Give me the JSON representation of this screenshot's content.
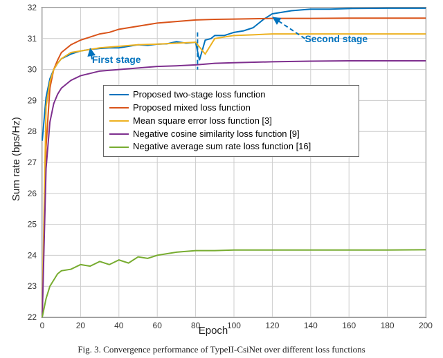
{
  "chart_data": {
    "type": "line",
    "title": "",
    "xlabel": "Epoch",
    "ylabel": "Sum rate (bps/Hz)",
    "xlim": [
      0,
      200
    ],
    "ylim": [
      22,
      32
    ],
    "xticks": [
      0,
      20,
      40,
      60,
      80,
      100,
      120,
      140,
      160,
      180,
      200
    ],
    "yticks": [
      22,
      23,
      24,
      25,
      26,
      27,
      28,
      29,
      30,
      31,
      32
    ],
    "grid": true,
    "legend_position": "inside-upper-left",
    "series": [
      {
        "name": "Proposed two-stage loss function",
        "color": "#0072bd",
        "x": [
          0,
          2,
          4,
          6,
          8,
          10,
          15,
          20,
          25,
          30,
          35,
          40,
          45,
          50,
          55,
          60,
          65,
          70,
          75,
          80,
          82,
          85,
          88,
          90,
          95,
          100,
          105,
          110,
          115,
          120,
          125,
          130,
          140,
          150,
          160,
          180,
          200
        ],
        "y": [
          27.7,
          29.1,
          29.7,
          30.0,
          30.2,
          30.35,
          30.5,
          30.6,
          30.65,
          30.68,
          30.7,
          30.7,
          30.75,
          30.8,
          30.78,
          30.82,
          30.83,
          30.9,
          30.85,
          30.88,
          30.3,
          30.95,
          31.0,
          31.1,
          31.1,
          31.2,
          31.25,
          31.35,
          31.6,
          31.8,
          31.85,
          31.9,
          31.95,
          31.95,
          31.97,
          31.98,
          31.98
        ]
      },
      {
        "name": "Proposed mixed loss function",
        "color": "#d95319",
        "x": [
          0,
          2,
          4,
          6,
          8,
          10,
          15,
          20,
          25,
          30,
          35,
          40,
          50,
          60,
          70,
          80,
          90,
          100,
          120,
          140,
          160,
          180,
          200
        ],
        "y": [
          22.1,
          27.5,
          29.4,
          30.0,
          30.3,
          30.55,
          30.8,
          30.95,
          31.05,
          31.15,
          31.2,
          31.3,
          31.4,
          31.5,
          31.55,
          31.6,
          31.62,
          31.63,
          31.65,
          31.65,
          31.66,
          31.66,
          31.66
        ]
      },
      {
        "name": "Mean square error loss function [3]",
        "color": "#edb120",
        "x": [
          0,
          2,
          4,
          6,
          8,
          10,
          15,
          20,
          30,
          40,
          50,
          60,
          70,
          80,
          85,
          90,
          100,
          110,
          120,
          140,
          160,
          180,
          200
        ],
        "y": [
          22.2,
          28.8,
          29.6,
          30.0,
          30.2,
          30.35,
          30.55,
          30.6,
          30.7,
          30.75,
          30.8,
          30.82,
          30.85,
          30.88,
          30.5,
          31.0,
          31.1,
          31.12,
          31.15,
          31.15,
          31.15,
          31.15,
          31.15
        ]
      },
      {
        "name": "Negative cosine similarity loss function [9]",
        "color": "#7e2f8e",
        "x": [
          0,
          2,
          4,
          6,
          8,
          10,
          15,
          20,
          30,
          40,
          50,
          60,
          70,
          80,
          90,
          100,
          120,
          140,
          160,
          180,
          200
        ],
        "y": [
          22.0,
          26.8,
          28.3,
          28.9,
          29.2,
          29.4,
          29.65,
          29.8,
          29.95,
          30.0,
          30.05,
          30.1,
          30.12,
          30.15,
          30.2,
          30.22,
          30.25,
          30.27,
          30.28,
          30.28,
          30.28
        ]
      },
      {
        "name": "Negative average sum rate loss function [16]",
        "color": "#77ac30",
        "x": [
          0,
          2,
          4,
          6,
          8,
          10,
          15,
          20,
          25,
          30,
          35,
          40,
          45,
          50,
          55,
          60,
          70,
          80,
          90,
          100,
          120,
          140,
          160,
          180,
          200
        ],
        "y": [
          22.0,
          22.6,
          23.0,
          23.2,
          23.4,
          23.5,
          23.55,
          23.7,
          23.65,
          23.8,
          23.7,
          23.85,
          23.75,
          23.95,
          23.9,
          24.0,
          24.1,
          24.15,
          24.15,
          24.17,
          24.17,
          24.17,
          24.17,
          24.17,
          24.18
        ]
      }
    ],
    "annotations": [
      {
        "text": "First stage",
        "x": 26,
        "y": 30.33,
        "arrow_to_x": 25,
        "arrow_to_y": 30.7
      },
      {
        "text": "Second stage",
        "x": 137,
        "y": 31.0,
        "arrow_to_x": 120,
        "arrow_to_y": 31.7
      }
    ],
    "stage_divider_x": 81
  },
  "caption": "Fig. 3.  Convergence performance of TypeII-CsiNet over different loss functions"
}
